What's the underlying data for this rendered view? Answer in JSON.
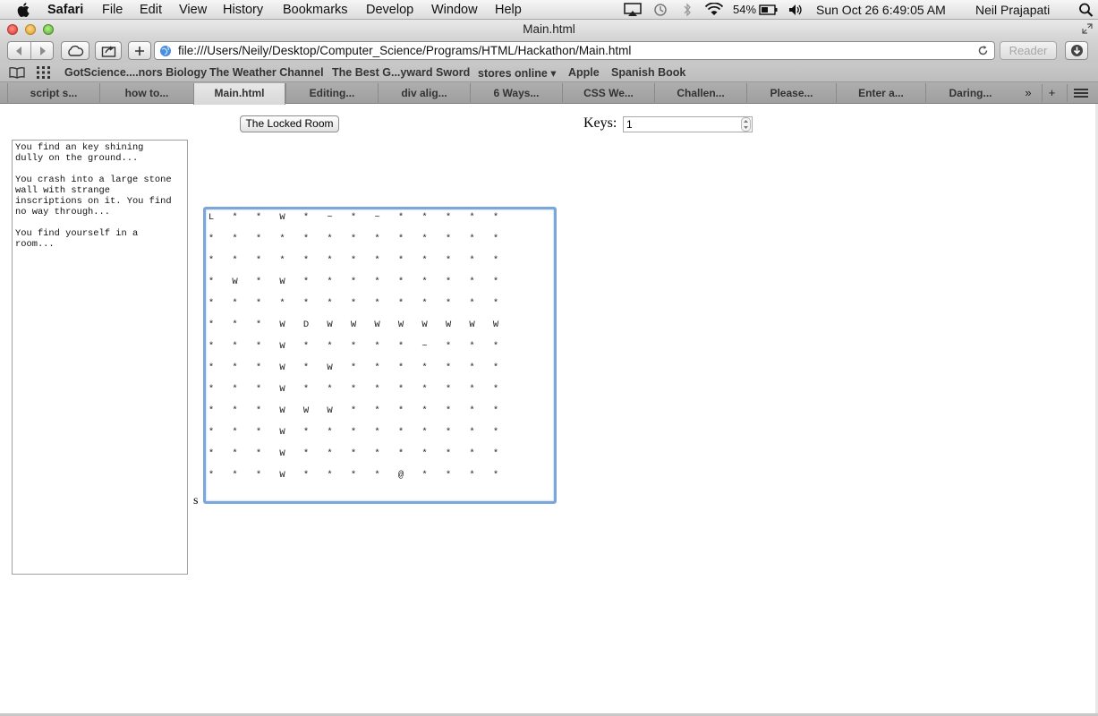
{
  "menubar": {
    "app": "Safari",
    "items": [
      "File",
      "Edit",
      "View",
      "History",
      "Bookmarks",
      "Develop",
      "Window",
      "Help"
    ],
    "battery": "54%",
    "clock": "Sun Oct 26  6:49:05 AM",
    "user": "Neil Prajapati"
  },
  "window": {
    "title": "Main.html"
  },
  "toolbar": {
    "url": "file:///Users/Neily/Desktop/Computer_Science/Programs/HTML/Hackathon/Main.html",
    "reader_label": "Reader"
  },
  "bookmarks": [
    "GotScience....nors Biology",
    "The Weather Channel",
    "The Best G...yward Sword",
    "stores online ▾",
    "Apple",
    "Spanish Book"
  ],
  "tabs": [
    "script s...",
    "how to...",
    "Main.html",
    "Editing...",
    "div alig...",
    "6 Ways...",
    "CSS We...",
    "Challen...",
    "Please...",
    "Enter a...",
    "Daring..."
  ],
  "active_tab": 2,
  "page": {
    "game_button": "The Locked Room",
    "keys_label": "Keys:",
    "keys_value": "1",
    "log_text": "You find an key shining\ndully on the ground...\n\nYou crash into a large stone\nwall with strange\ninscriptions on it. You find\nno way through...\n\nYou find yourself in a\nroom...",
    "map_side_label": "s",
    "map_rows": [
      [
        "L",
        "*",
        "*",
        "W",
        "*",
        "~",
        "*",
        "~",
        "*",
        "*",
        "*",
        "*",
        "*"
      ],
      [
        "*",
        "*",
        "*",
        "*",
        "*",
        "*",
        "*",
        "*",
        "*",
        "*",
        "*",
        "*",
        "*"
      ],
      [
        "*",
        "*",
        "*",
        "*",
        "*",
        "*",
        "*",
        "*",
        "*",
        "*",
        "*",
        "*",
        "*"
      ],
      [
        "*",
        "W",
        "*",
        "W",
        "*",
        "*",
        "*",
        "*",
        "*",
        "*",
        "*",
        "*",
        "*"
      ],
      [
        "*",
        "*",
        "*",
        "*",
        "*",
        "*",
        "*",
        "*",
        "*",
        "*",
        "*",
        "*",
        "*"
      ],
      [
        "*",
        "*",
        "*",
        "W",
        "D",
        "W",
        "W",
        "W",
        "W",
        "W",
        "W",
        "W",
        "W"
      ],
      [
        "*",
        "*",
        "*",
        "W",
        "*",
        "*",
        "*",
        "*",
        "*",
        "~",
        "*",
        "*",
        "*"
      ],
      [
        "*",
        "*",
        "*",
        "W",
        "*",
        "W",
        "*",
        "*",
        "*",
        "*",
        "*",
        "*",
        "*"
      ],
      [
        "*",
        "*",
        "*",
        "W",
        "*",
        "*",
        "*",
        "*",
        "*",
        "*",
        "*",
        "*",
        "*"
      ],
      [
        "*",
        "*",
        "*",
        "W",
        "W",
        "W",
        "*",
        "*",
        "*",
        "*",
        "*",
        "*",
        "*"
      ],
      [
        "*",
        "*",
        "*",
        "W",
        "*",
        "*",
        "*",
        "*",
        "*",
        "*",
        "*",
        "*",
        "*"
      ],
      [
        "*",
        "*",
        "*",
        "W",
        "*",
        "*",
        "*",
        "*",
        "*",
        "*",
        "*",
        "*",
        "*"
      ],
      [
        "*",
        "*",
        "*",
        "W",
        "*",
        "*",
        "*",
        "*",
        "@",
        "*",
        "*",
        "*",
        "*"
      ]
    ]
  }
}
